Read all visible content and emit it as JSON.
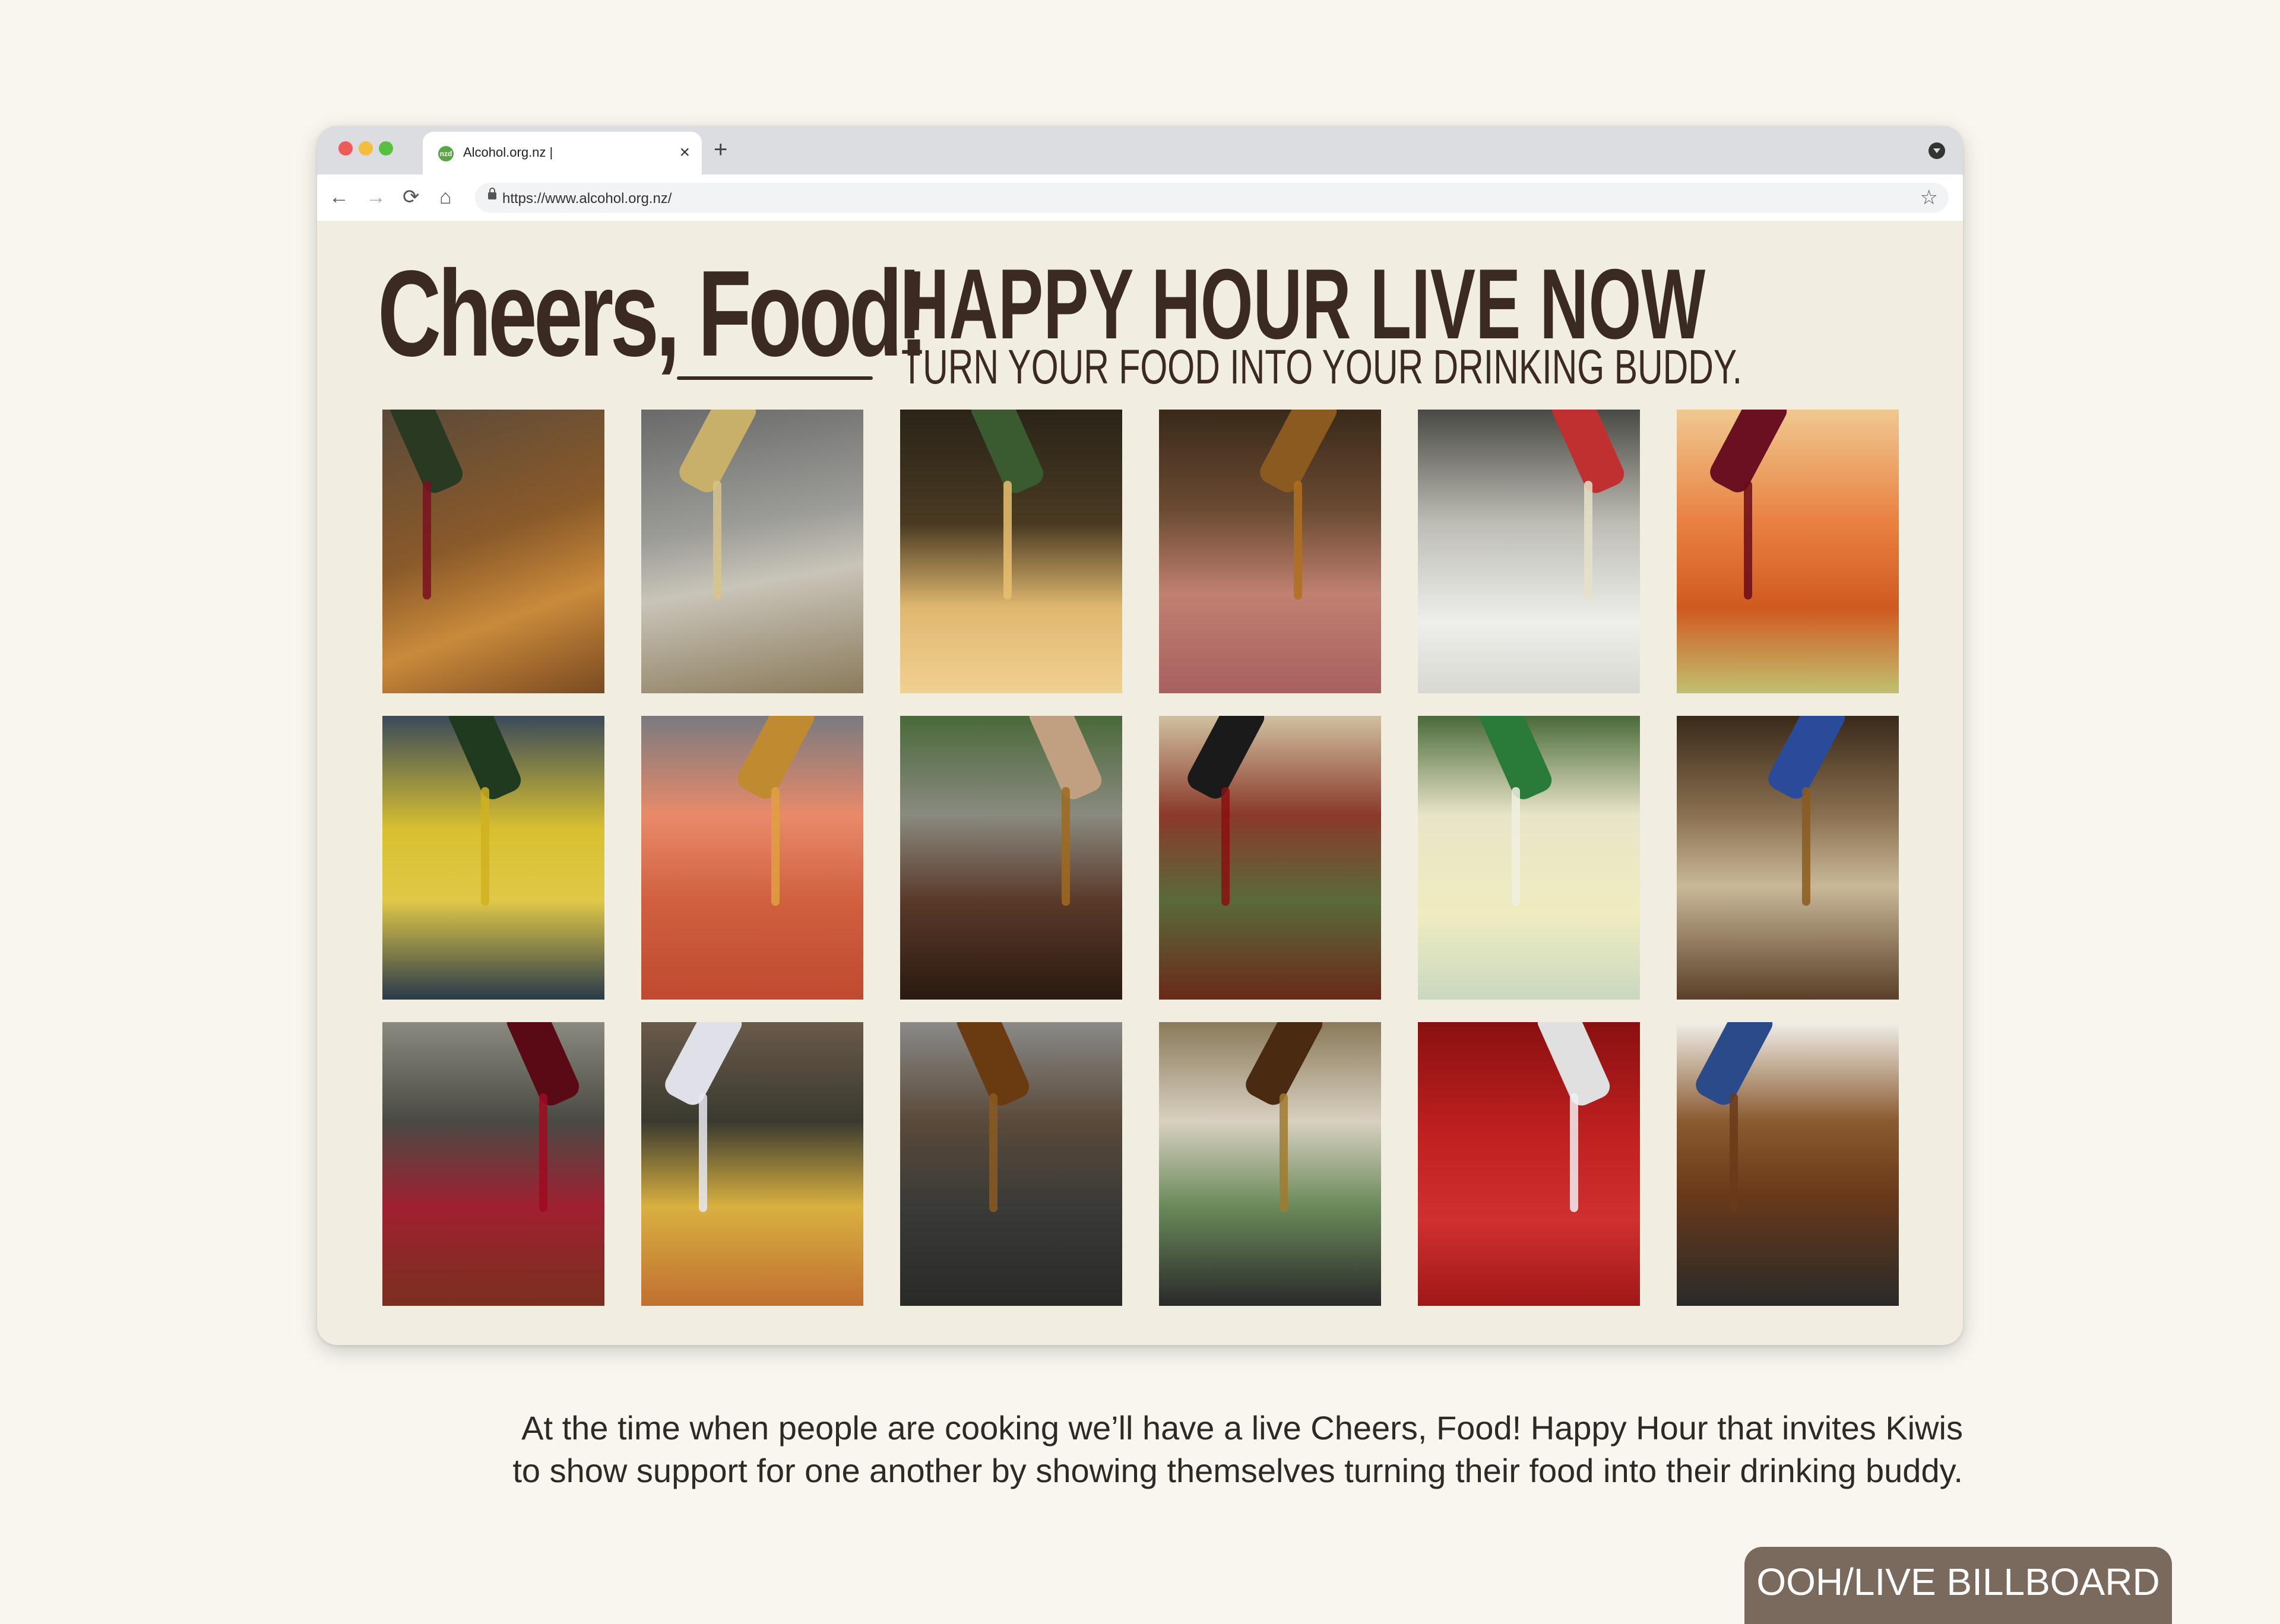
{
  "browser": {
    "tab_title": "Alcohol.org.nz |",
    "favicon_text": "nzd",
    "tab_close": "×",
    "new_tab": "+",
    "url": "https://www.alcohol.org.nz/",
    "icons": {
      "back": "←",
      "forward": "→",
      "reload": "⟳",
      "home": "⌂",
      "star": "☆"
    }
  },
  "page": {
    "brand": "Cheers, Food!",
    "headline": "HAPPY HOUR LIVE NOW",
    "subline": "TURN YOUR FOOD INTO  YOUR DRINKING BUDDY.",
    "photos": [
      {
        "name": "wine-into-onion-pan",
        "bg": "linear-gradient(160deg,#5a4a3a 0%,#8a5a2a 45%,#c98a3a 70%,#7a4a22 100%)",
        "pour": "#7a1020",
        "bottle": "#2a3a22"
      },
      {
        "name": "pouring-into-skillet",
        "bg": "linear-gradient(170deg,#6a6a6a 0%,#9a9a96 40%,#c8c4b8 60%,#8a7a5a 100%)",
        "pour": "#d8c48a",
        "bottle": "#c9b06a"
      },
      {
        "name": "beer-into-gnocchi",
        "bg": "linear-gradient(180deg,#2a2418 0%,#4a3a22 40%,#e0b870 70%,#f0d090 100%)",
        "pour": "#e8c070",
        "bottle": "#3a5a30"
      },
      {
        "name": "liquor-over-pork",
        "bg": "linear-gradient(180deg,#3a2a1a 0%,#6a4a32 35%,#c08070 65%,#a86060 100%)",
        "pour": "#b07020",
        "bottle": "#8a5a20"
      },
      {
        "name": "can-into-flour",
        "bg": "linear-gradient(180deg,#4a4a44 0%,#bdbdb6 40%,#eeeeea 75%,#d8d8d2 100%)",
        "pour": "#e6e0c8",
        "bottle": "#c03030"
      },
      {
        "name": "wine-into-vegetables",
        "bg": "linear-gradient(180deg,#f0c890 0%,#e88040 40%,#d05a20 70%,#c0c070 100%)",
        "pour": "#6a0a18",
        "bottle": "#6a1020"
      },
      {
        "name": "wine-into-butter",
        "bg": "linear-gradient(180deg,#3a4a5a 0%,#d8c030 40%,#e0c848 65%,#2a3a4a 100%)",
        "pour": "#d0b020",
        "bottle": "#203a20"
      },
      {
        "name": "spirit-into-stew-pot",
        "bg": "linear-gradient(180deg,#7a7a80 0%,#e88a6a 35%,#d06040 65%,#c04a30 100%)",
        "pour": "#e0a040",
        "bottle": "#c08a30"
      },
      {
        "name": "whiskey-into-marinade",
        "bg": "linear-gradient(180deg,#4a6a3a 0%,#8a8a80 35%,#5a3a2a 65%,#2a1a10 100%)",
        "pour": "#a06a20",
        "bottle": "#c0a080"
      },
      {
        "name": "wine-into-roast-veg",
        "bg": "linear-gradient(180deg,#d0c0a0 0%,#8a3a2a 35%,#5a6a3a 65%,#6a2a1a 100%)",
        "pour": "#8a1010",
        "bottle": "#1a1a1a"
      },
      {
        "name": "gin-into-batter",
        "bg": "linear-gradient(180deg,#4a6a3a 0%,#e8e4c8 35%,#f0ecc0 70%,#c8d8c0 100%)",
        "pour": "#f0f0e0",
        "bottle": "#2a7a3a"
      },
      {
        "name": "brandy-over-mushrooms",
        "bg": "linear-gradient(180deg,#3a2a1a 0%,#8a7050 35%,#c8b898 60%,#5a4028 100%)",
        "pour": "#8a5a20",
        "bottle": "#2a4a9a"
      },
      {
        "name": "red-wine-into-pot",
        "bg": "linear-gradient(180deg,#8a8a80 0%,#4a4a44 35%,#a02030 65%,#7a3020 100%)",
        "pour": "#a00a20",
        "bottle": "#5a0a14"
      },
      {
        "name": "vodka-into-stir-fry",
        "bg": "linear-gradient(180deg,#6a5a4a 0%,#3a3a30 35%,#d8b040 65%,#c07030 100%)",
        "pour": "#e8e8f0",
        "bottle": "#e0e0e8"
      },
      {
        "name": "whiskey-into-skillet",
        "bg": "linear-gradient(180deg,#8a8a88 0%,#5a4a3a 35%,#3a3a38 65%,#2a2a28 100%)",
        "pour": "#8a5a20",
        "bottle": "#6a3a10"
      },
      {
        "name": "beer-into-dutch-oven",
        "bg": "linear-gradient(180deg,#8a7a5a 0%,#d8d0c0 35%,#6a8a5a 65%,#2a2a2a 100%)",
        "pour": "#a07a30",
        "bottle": "#4a2a10"
      },
      {
        "name": "vodka-into-tomato-sauce",
        "bg": "linear-gradient(180deg,#8a1010 0%,#c02020 40%,#d03030 70%,#a01818 100%)",
        "pour": "#f0f0f0",
        "bottle": "#e0e0e0"
      },
      {
        "name": "beer-can-chicken",
        "bg": "linear-gradient(180deg,#f0eee8 0%,#8a5a30 35%,#6a3a1a 60%,#2a2a2a 100%)",
        "pour": "#6a3a1a",
        "bottle": "#2a4a8a"
      }
    ]
  },
  "caption": {
    "line1": "At the time when people are cooking we’ll have a live Cheers, Food! Happy Hour that invites Kiwis",
    "line2": "to show support for one another by showing themselves turning their food into their drinking buddy."
  },
  "badge": {
    "label": "OOH/LIVE BILLBOARD"
  },
  "colors": {
    "page_bg": "#f8f6ef",
    "content_bg": "#f1ede0",
    "brand_text": "#3a2a22",
    "badge_bg": "#7a6a5e"
  }
}
